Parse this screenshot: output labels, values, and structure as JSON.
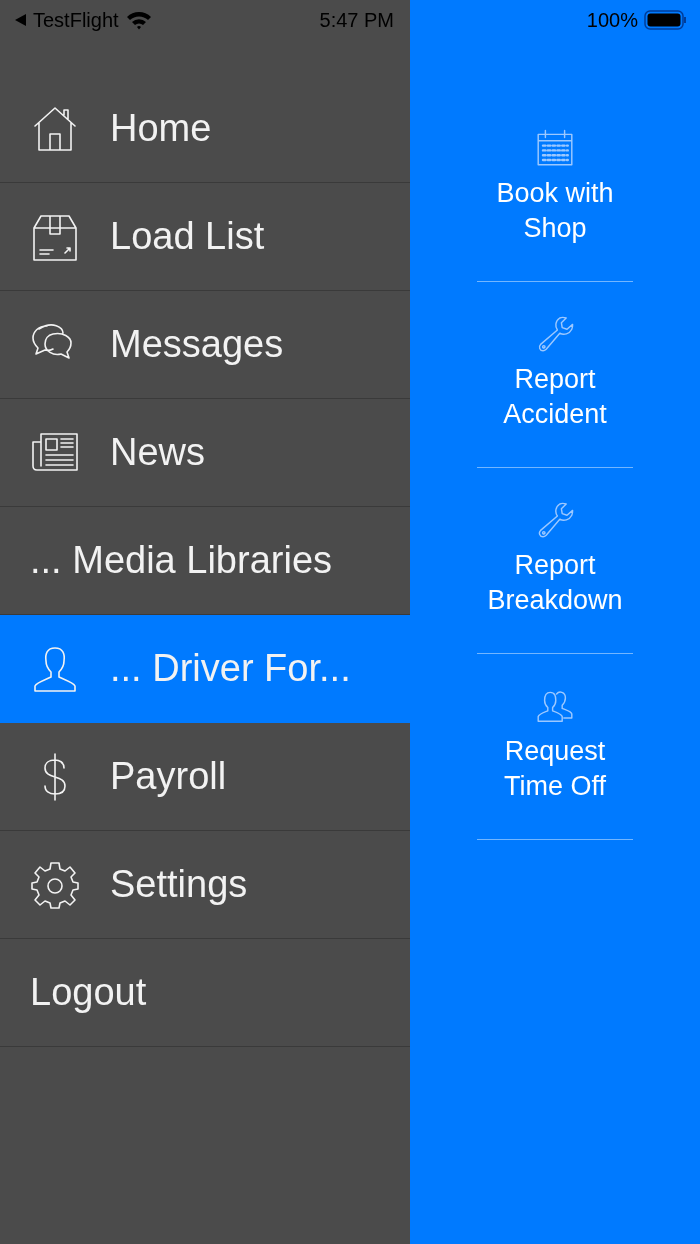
{
  "status_bar": {
    "back_app": "TestFlight",
    "time": "5:47 PM",
    "battery": "100%"
  },
  "menu": [
    {
      "label": "Home",
      "kind": "home",
      "selected": false
    },
    {
      "label": "Load List",
      "kind": "box",
      "selected": false
    },
    {
      "label": "Messages",
      "kind": "chat",
      "selected": false
    },
    {
      "label": "News",
      "kind": "news",
      "selected": false
    },
    {
      "label": "... Media Libraries",
      "kind": "plain",
      "selected": false
    },
    {
      "label": "... Driver For...",
      "kind": "person",
      "selected": true
    },
    {
      "label": "Payroll",
      "kind": "dollar",
      "selected": false
    },
    {
      "label": "Settings",
      "kind": "gear",
      "selected": false
    },
    {
      "label": "Logout",
      "kind": "plain",
      "selected": false
    }
  ],
  "actions": [
    {
      "label": "Book with Shop",
      "kind": "calendar"
    },
    {
      "label": "Report Accident",
      "kind": "wrench"
    },
    {
      "label": "Report Breakdown",
      "kind": "wrench"
    },
    {
      "label": "Request Time Off",
      "kind": "people"
    }
  ]
}
